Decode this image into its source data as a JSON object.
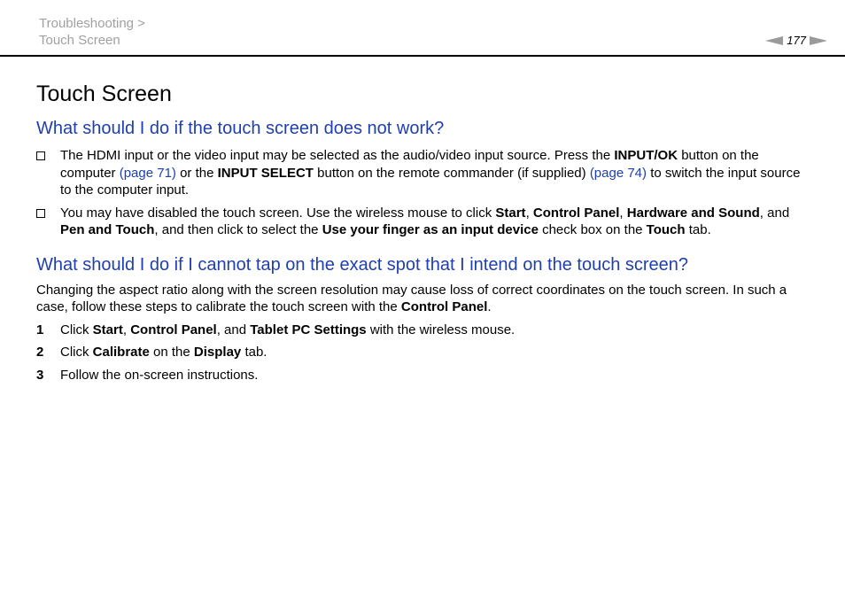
{
  "header": {
    "breadcrumb_section": "Troubleshooting >",
    "breadcrumb_page": "Touch Screen",
    "page_number": "177"
  },
  "title": "Touch Screen",
  "section1": {
    "heading": "What should I do if the touch screen does not work?",
    "item1": {
      "t1": "The HDMI input or the video input may be selected as the audio/video input source. Press the ",
      "b1": "INPUT/OK",
      "t2": " button on the computer ",
      "link1": "(page 71)",
      "t3": " or the ",
      "b2": "INPUT SELECT",
      "t4": " button on the remote commander (if supplied) ",
      "link2": "(page 74)",
      "t5": " to switch the input source to the computer input."
    },
    "item2": {
      "t1": "You may have disabled the touch screen. Use the wireless mouse to click ",
      "b1": "Start",
      "t2": ", ",
      "b2": "Control Panel",
      "t3": ", ",
      "b3": "Hardware and Sound",
      "t4": ", and ",
      "b4": "Pen and Touch",
      "t5": ", and then click to select the ",
      "b5": "Use your finger as an input device",
      "t6": " check box on the ",
      "b6": "Touch",
      "t7": " tab."
    }
  },
  "section2": {
    "heading": "What should I do if I cannot tap on the exact spot that I intend on the touch screen?",
    "intro": {
      "t1": "Changing the aspect ratio along with the screen resolution may cause loss of correct coordinates on the touch screen. In such a case, follow these steps to calibrate the touch screen with the ",
      "b1": "Control Panel",
      "t2": "."
    },
    "steps": [
      {
        "num": "1",
        "t1": "Click ",
        "b1": "Start",
        "t2": ", ",
        "b2": "Control Panel",
        "t3": ", and ",
        "b3": "Tablet PC Settings",
        "t4": " with the wireless mouse."
      },
      {
        "num": "2",
        "t1": "Click ",
        "b1": "Calibrate",
        "t2": " on the ",
        "b2": "Display",
        "t3": " tab."
      },
      {
        "num": "3",
        "t1": "Follow the on-screen instructions."
      }
    ]
  },
  "colors": {
    "heading_blue": "#1f3fb0",
    "breadcrumb_gray": "#a0a0a0",
    "arrow_gray": "#9a9a9a"
  }
}
